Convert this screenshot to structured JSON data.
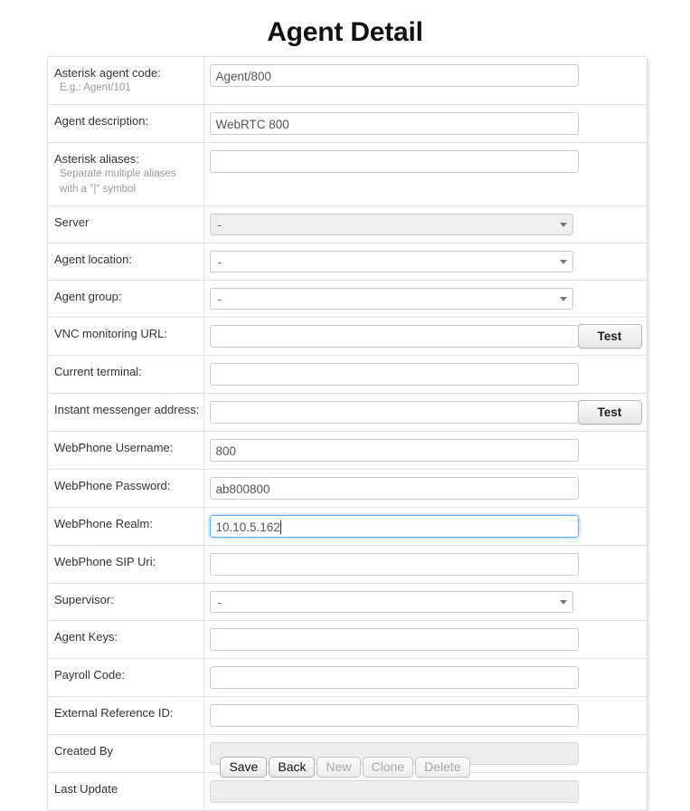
{
  "page": {
    "title": "Agent Detail"
  },
  "form": {
    "rows": [
      {
        "label": "Asterisk agent code:",
        "hint": "E.g.: Agent/101",
        "type": "text",
        "value": "Agent/800",
        "placeholder": "",
        "state": "normal",
        "has_test": false
      },
      {
        "label": "Agent description:",
        "hint": "",
        "type": "text",
        "value": "WebRTC 800",
        "placeholder": "",
        "state": "normal",
        "has_test": false
      },
      {
        "label": "Asterisk aliases:",
        "hint": "Separate multiple aliases\nwith a \"|\" symbol",
        "hint_line1": "Separate multiple aliases",
        "hint_line2": "with a \"|\" symbol",
        "type": "text",
        "value": "",
        "placeholder": "",
        "state": "normal",
        "has_test": false
      },
      {
        "label": "Server",
        "hint": "",
        "type": "select",
        "value": "-",
        "state": "disabled",
        "has_test": false
      },
      {
        "label": "Agent location:",
        "hint": "",
        "type": "select",
        "value": "-",
        "state": "normal",
        "has_test": false
      },
      {
        "label": "Agent group:",
        "hint": "",
        "type": "select",
        "value": "-",
        "state": "normal",
        "has_test": false
      },
      {
        "label": "VNC monitoring URL:",
        "hint": "",
        "type": "text",
        "value": "",
        "placeholder": "",
        "state": "normal",
        "has_test": true,
        "test_label": "Test"
      },
      {
        "label": "Current terminal:",
        "hint": "",
        "type": "text",
        "value": "",
        "placeholder": "",
        "state": "normal",
        "has_test": false
      },
      {
        "label": "Instant messenger address:",
        "hint": "",
        "type": "text",
        "value": "",
        "placeholder": "",
        "state": "normal",
        "has_test": true,
        "test_label": "Test"
      },
      {
        "label": "WebPhone Username:",
        "hint": "",
        "type": "text",
        "value": "800",
        "placeholder": "",
        "state": "normal",
        "has_test": false
      },
      {
        "label": "WebPhone Password:",
        "hint": "",
        "type": "text",
        "value": "ab800800",
        "placeholder": "",
        "state": "normal",
        "has_test": false
      },
      {
        "label": "WebPhone Realm:",
        "hint": "",
        "type": "text",
        "value": "10.10.5.162",
        "placeholder": "",
        "state": "focused",
        "has_test": false
      },
      {
        "label": "WebPhone SIP Uri:",
        "hint": "",
        "type": "text",
        "value": "",
        "placeholder": "",
        "state": "normal",
        "has_test": false
      },
      {
        "label": "Supervisor:",
        "hint": "",
        "type": "select",
        "value": "-",
        "state": "normal",
        "has_test": false
      },
      {
        "label": "Agent Keys:",
        "hint": "",
        "type": "text",
        "value": "",
        "placeholder": "",
        "state": "normal",
        "has_test": false
      },
      {
        "label": "Payroll Code:",
        "hint": "",
        "type": "text",
        "value": "",
        "placeholder": "",
        "state": "normal",
        "has_test": false
      },
      {
        "label": "External Reference ID:",
        "hint": "",
        "type": "text",
        "value": "",
        "placeholder": "",
        "state": "normal",
        "has_test": false
      },
      {
        "label": "Created By",
        "hint": "",
        "type": "text",
        "value": "",
        "placeholder": "",
        "state": "disabled",
        "has_test": false
      },
      {
        "label": "Last Update",
        "hint": "",
        "type": "text",
        "value": "",
        "placeholder": "",
        "state": "disabled",
        "has_test": false
      }
    ]
  },
  "actions": {
    "buttons": [
      {
        "label": "Save",
        "name": "save-button",
        "enabled": true
      },
      {
        "label": "Back",
        "name": "back-button",
        "enabled": true
      },
      {
        "label": "New",
        "name": "new-button",
        "enabled": false
      },
      {
        "label": "Clone",
        "name": "clone-button",
        "enabled": false
      },
      {
        "label": "Delete",
        "name": "delete-button",
        "enabled": false
      }
    ]
  },
  "colors": {
    "focus_border": "#66afe9",
    "frame_border": "#dddddd",
    "row_divider": "#e3e3e3",
    "disabled_field": "#ededed",
    "hint_text": "#999999",
    "label_text": "#333333"
  }
}
